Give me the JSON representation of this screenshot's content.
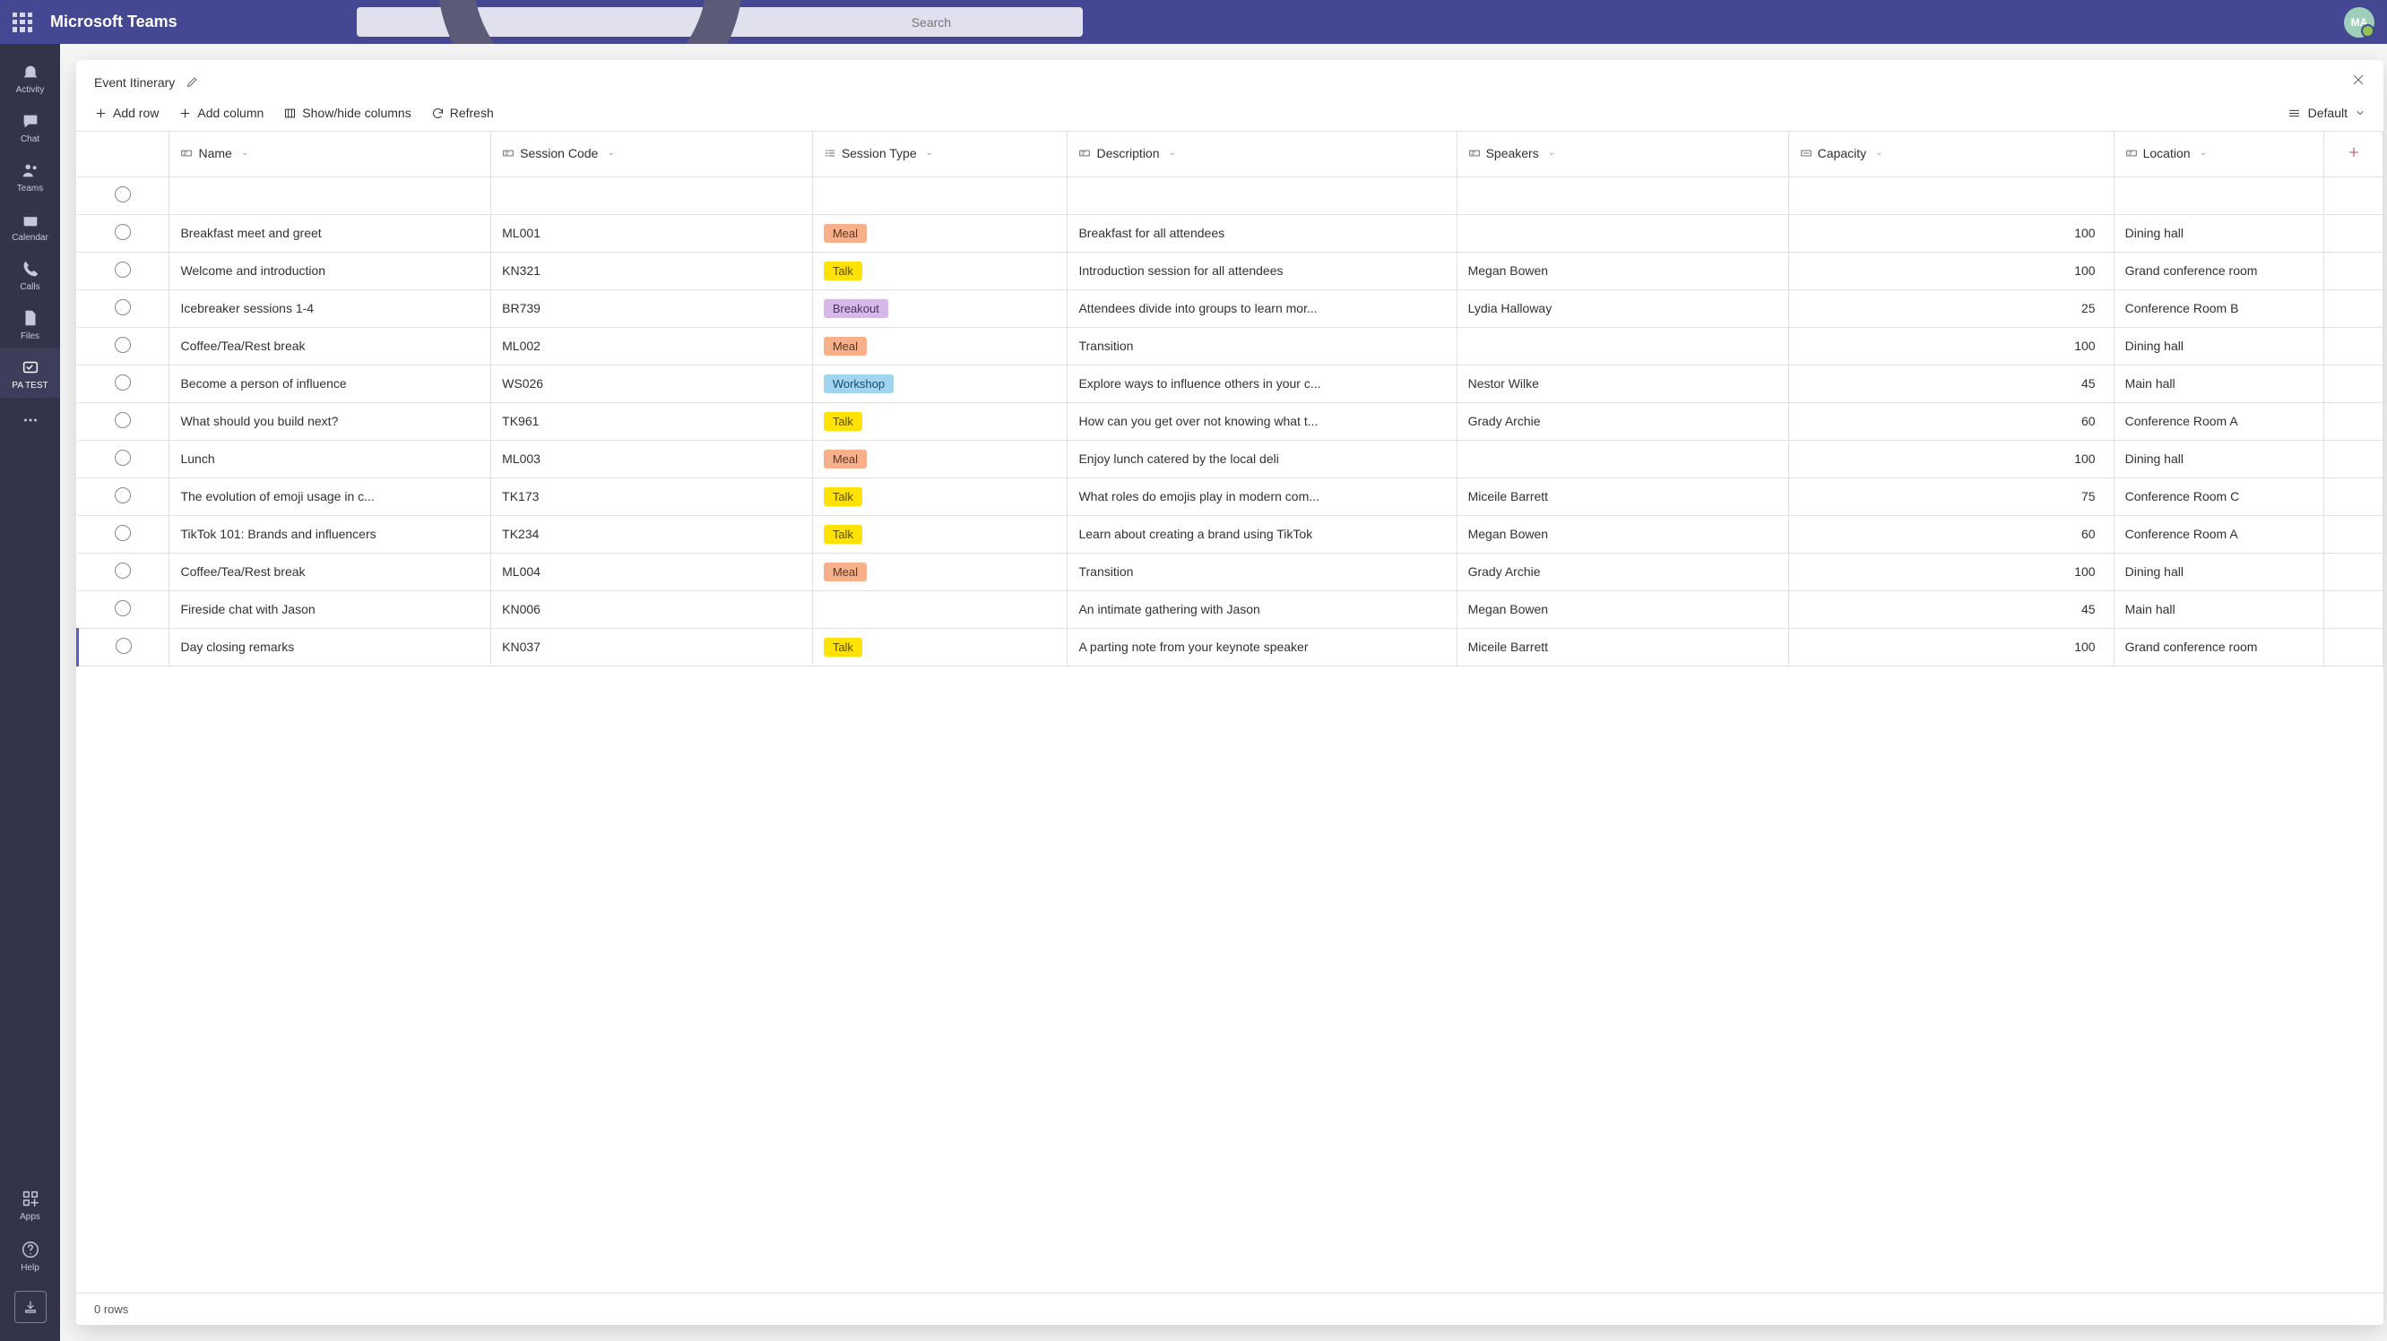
{
  "app": {
    "title": "Microsoft Teams",
    "search_placeholder": "Search",
    "avatar_initials": "MA"
  },
  "rail": {
    "items": [
      {
        "label": "Activity"
      },
      {
        "label": "Chat"
      },
      {
        "label": "Teams"
      },
      {
        "label": "Calendar"
      },
      {
        "label": "Calls"
      },
      {
        "label": "Files"
      },
      {
        "label": "PA TEST"
      }
    ],
    "apps": "Apps",
    "help": "Help"
  },
  "panel": {
    "title": "Event Itinerary",
    "toolbar": {
      "add_row": "Add row",
      "add_column": "Add column",
      "show_hide": "Show/hide columns",
      "refresh": "Refresh",
      "view": "Default"
    },
    "columns": [
      "Name",
      "Session Code",
      "Session Type",
      "Description",
      "Speakers",
      "Capacity",
      "Location"
    ],
    "rows": [
      {
        "name": "Breakfast meet and greet",
        "code": "ML001",
        "type": "Meal",
        "desc": "Breakfast for all attendees",
        "speakers": "",
        "capacity": 100,
        "location": "Dining hall"
      },
      {
        "name": "Welcome and introduction",
        "code": "KN321",
        "type": "Talk",
        "desc": "Introduction session for all attendees",
        "speakers": "Megan Bowen",
        "capacity": 100,
        "location": "Grand conference room"
      },
      {
        "name": "Icebreaker sessions 1-4",
        "code": "BR739",
        "type": "Breakout",
        "desc": "Attendees divide into groups to learn mor...",
        "speakers": "Lydia Halloway",
        "capacity": 25,
        "location": "Conference Room B"
      },
      {
        "name": "Coffee/Tea/Rest break",
        "code": "ML002",
        "type": "Meal",
        "desc": "Transition",
        "speakers": "",
        "capacity": 100,
        "location": "Dining hall"
      },
      {
        "name": "Become a person of influence",
        "code": "WS026",
        "type": "Workshop",
        "desc": "Explore ways to influence others in your c...",
        "speakers": "Nestor Wilke",
        "capacity": 45,
        "location": "Main hall"
      },
      {
        "name": "What should you build next?",
        "code": "TK961",
        "type": "Talk",
        "desc": "How can you get over not knowing what t...",
        "speakers": "Grady Archie",
        "capacity": 60,
        "location": "Conference Room A"
      },
      {
        "name": "Lunch",
        "code": "ML003",
        "type": "Meal",
        "desc": "Enjoy lunch catered by the local deli",
        "speakers": "",
        "capacity": 100,
        "location": "Dining hall"
      },
      {
        "name": "The evolution of emoji usage in c...",
        "code": "TK173",
        "type": "Talk",
        "desc": "What roles do emojis play in modern com...",
        "speakers": "Miceile Barrett",
        "capacity": 75,
        "location": "Conference Room C"
      },
      {
        "name": "TikTok 101: Brands and influencers",
        "code": "TK234",
        "type": "Talk",
        "desc": "Learn about creating a brand using TikTok",
        "speakers": "Megan Bowen",
        "capacity": 60,
        "location": "Conference Room A"
      },
      {
        "name": "Coffee/Tea/Rest break",
        "code": "ML004",
        "type": "Meal",
        "desc": "Transition",
        "speakers": "Grady Archie",
        "capacity": 100,
        "location": "Dining hall"
      },
      {
        "name": "Fireside chat with Jason",
        "code": "KN006",
        "type": "",
        "desc": "An intimate gathering with Jason",
        "speakers": "Megan Bowen",
        "capacity": 45,
        "location": "Main hall"
      },
      {
        "name": "Day closing remarks",
        "code": "KN037",
        "type": "Talk",
        "desc": "A parting note from your keynote speaker",
        "speakers": "Miceile Barrett",
        "capacity": 100,
        "location": "Grand conference room"
      }
    ],
    "footer": "0 rows"
  }
}
